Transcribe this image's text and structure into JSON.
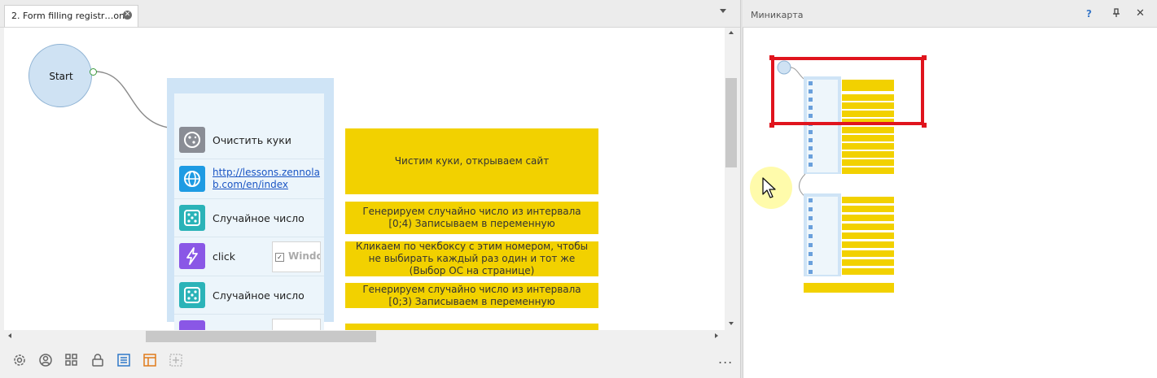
{
  "editor": {
    "tab_title": "2. Form filling registr…on",
    "tab_close_icon": "close-circle-icon",
    "start_label": "Start",
    "actions": [
      {
        "type": "label",
        "label": "Очистить куки",
        "icon": "cookie-icon",
        "icon_color": "#8a8d95"
      },
      {
        "type": "link",
        "label": "http://lessons.zennolab.com/en/index",
        "line1": "http://lessons.zennola",
        "line2": "b.com/en/index",
        "icon": "globe-icon",
        "icon_color": "#1e9be3"
      },
      {
        "type": "label",
        "label": "Случайное число",
        "icon": "dice-icon",
        "icon_color": "#2bb3b8"
      },
      {
        "type": "label",
        "label": "click",
        "icon": "lightning-icon",
        "icon_color": "#8a57e6",
        "preview_text": "Windo"
      },
      {
        "type": "label",
        "label": "Случайное число",
        "icon": "dice-icon",
        "icon_color": "#2bb3b8"
      }
    ],
    "notes": [
      "Чистим куки, открываем сайт",
      "Генерируем случайно число из интервала [0;4) Записываем в переменную",
      "Кликаем по чекбоксу с этим номером, чтобы не выбирать каждый раз один и тот же (Выбор ОС на странице)",
      "Генерируем случайно число из интервала [0;3) Записываем в переменную"
    ],
    "bottom_toolbar": [
      "settings-icon",
      "user-icon",
      "grid-icon",
      "lock-icon",
      "list-icon",
      "table-icon",
      "add-icon"
    ],
    "more_label": "..."
  },
  "minimap": {
    "title": "Миникарта",
    "help_label": "?",
    "pin_icon": "pin-icon",
    "close_label": "✕",
    "frame_color": "#e0141d"
  },
  "colors": {
    "note_yellow": "#f2d100",
    "group_blue": "#cfe4f6",
    "start_fill": "#cfe2f3",
    "link_blue": "#1a55c4"
  }
}
